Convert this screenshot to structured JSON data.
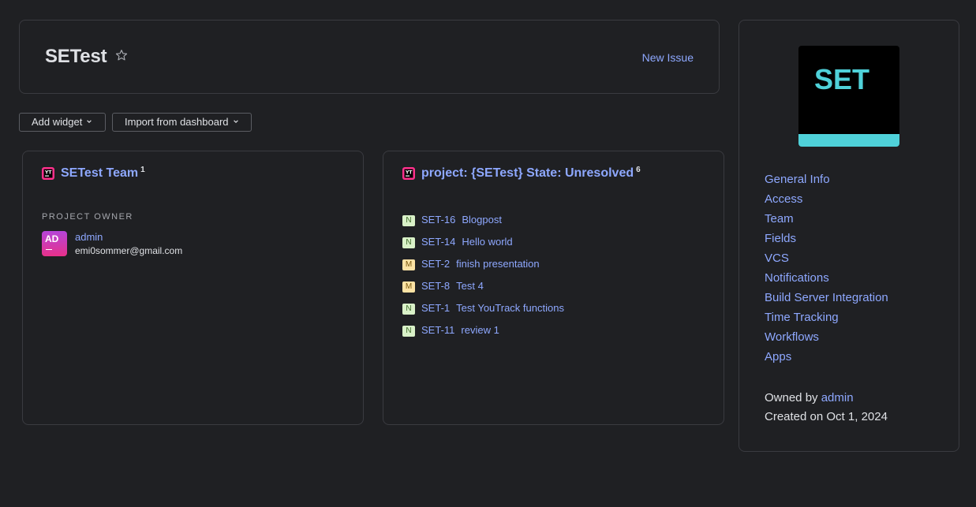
{
  "header": {
    "title": "SETest",
    "star_icon": "star-outline-icon",
    "new_issue_label": "New Issue"
  },
  "toolbar": {
    "add_widget_label": "Add widget",
    "import_label": "Import from dashboard"
  },
  "team_widget": {
    "title": "SETest Team",
    "count": "1",
    "owner_label": "PROJECT OWNER",
    "owner": {
      "initials": "AD",
      "name": "admin",
      "email": "emi0sommer@gmail.com"
    }
  },
  "issues_widget": {
    "title": "project: {SETest} State: Unresolved",
    "count": "6",
    "issues": [
      {
        "priority": "N",
        "id": "SET-16",
        "summary": "Blogpost"
      },
      {
        "priority": "N",
        "id": "SET-14",
        "summary": "Hello world"
      },
      {
        "priority": "M",
        "id": "SET-2",
        "summary": "finish presentation"
      },
      {
        "priority": "M",
        "id": "SET-8",
        "summary": "Test 4"
      },
      {
        "priority": "N",
        "id": "SET-1",
        "summary": "Test YouTrack functions"
      },
      {
        "priority": "N",
        "id": "SET-11",
        "summary": "review 1"
      }
    ]
  },
  "sidebar": {
    "logo_text": "SET",
    "links": [
      "General Info",
      "Access",
      "Team",
      "Fields",
      "VCS",
      "Notifications",
      "Build Server Integration",
      "Time Tracking",
      "Workflows",
      "Apps"
    ],
    "owned_by_prefix": "Owned by",
    "owned_by_name": "admin",
    "created_on": "Created on Oct 1, 2024"
  },
  "colors": {
    "background": "#1f2023",
    "link": "#8ea8ff",
    "logo_accent": "#4fd1d9",
    "priority_normal": "#d9f1c8",
    "priority_major": "#fbe2a4"
  }
}
